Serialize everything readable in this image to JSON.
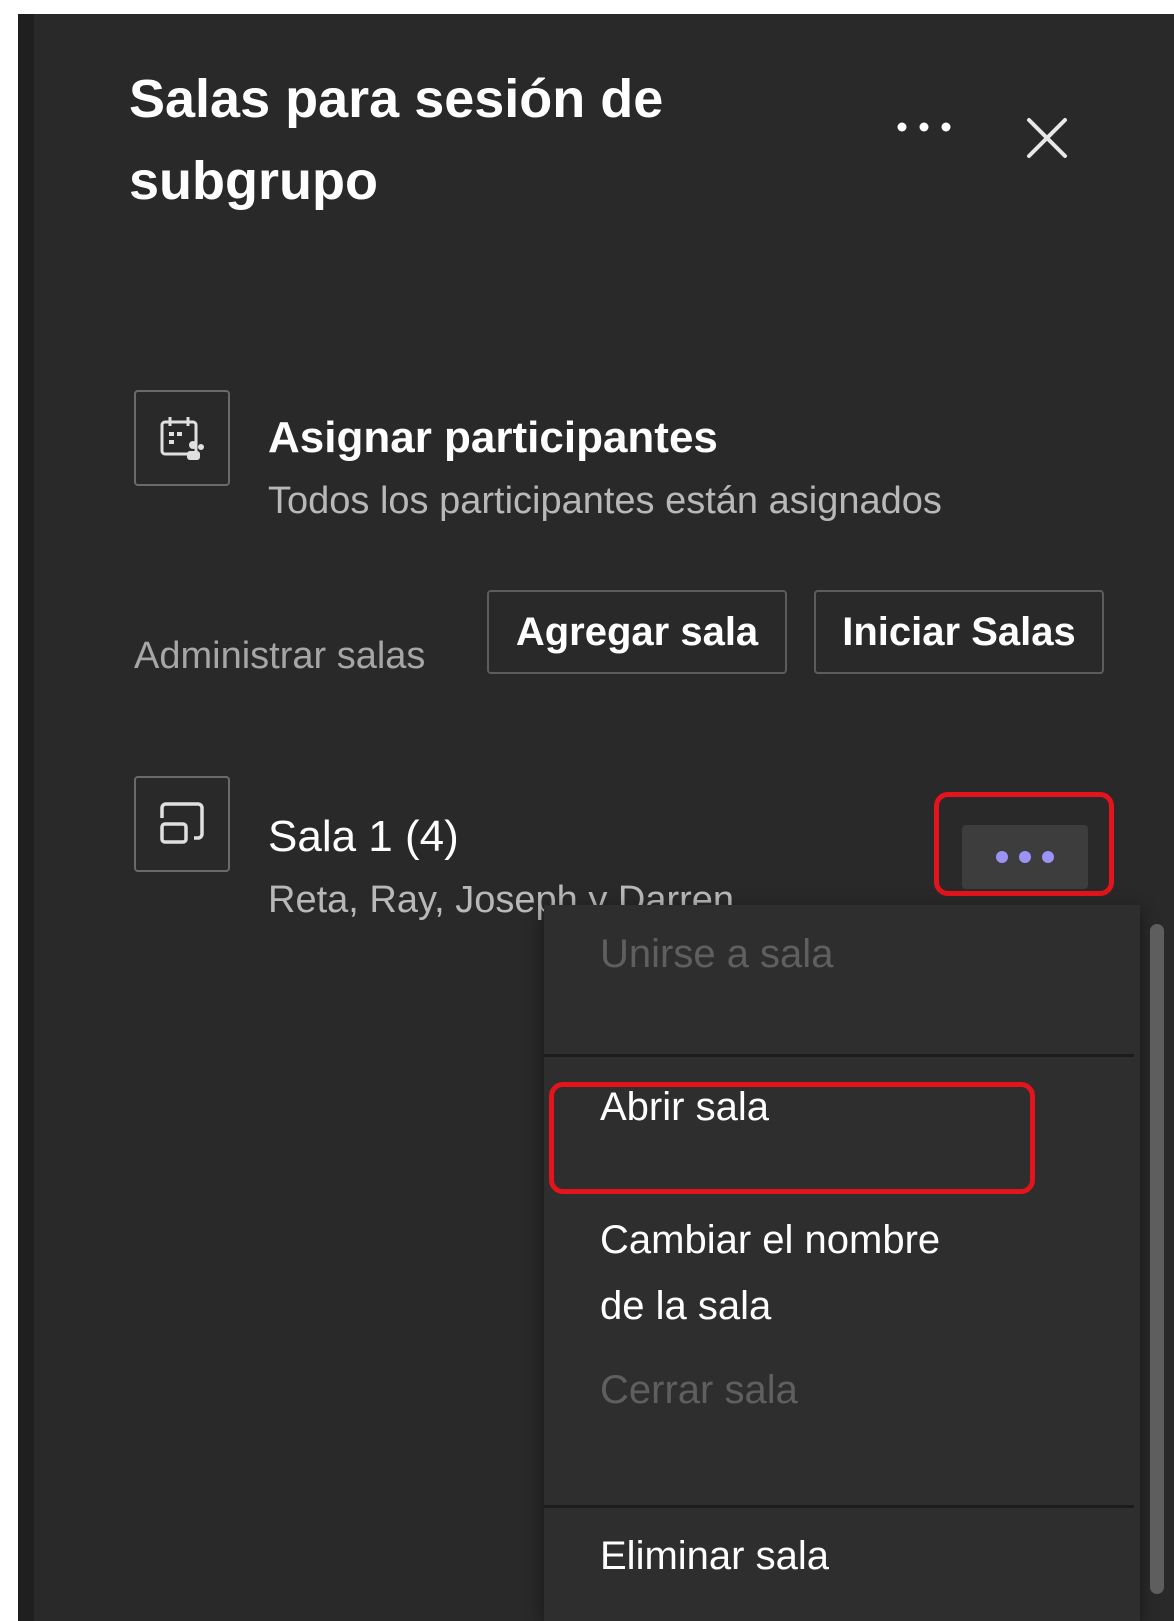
{
  "panel": {
    "title": "Salas para sesión de subgrupo",
    "more_icon": "more-horizontal-icon",
    "close_icon": "close-icon"
  },
  "assign": {
    "icon": "calendar-people-icon",
    "title": "Asignar participantes",
    "subtitle": "Todos los participantes están asignados"
  },
  "manage": {
    "label": "Administrar salas",
    "add_room": "Agregar sala",
    "start_rooms": "Iniciar Salas"
  },
  "room": {
    "icon": "breakout-room-icon",
    "title": "Sala 1 (4)",
    "participants": "Reta, Ray, Joseph y Darren",
    "more_icon": "more-horizontal-icon"
  },
  "context_menu": {
    "items": [
      {
        "label": "Unirse a sala",
        "enabled": false
      },
      {
        "label": "Abrir sala",
        "enabled": true
      },
      {
        "label": "Cambiar el nombre de la sala",
        "enabled": true
      },
      {
        "label": "Cerrar sala",
        "enabled": false
      },
      {
        "label": "Eliminar sala",
        "enabled": true
      }
    ]
  },
  "colors": {
    "panel_bg": "#292929",
    "menu_bg": "#2e2e2e",
    "highlight_outline": "#e3141b",
    "more_dots_accent": "#9b93f5"
  }
}
